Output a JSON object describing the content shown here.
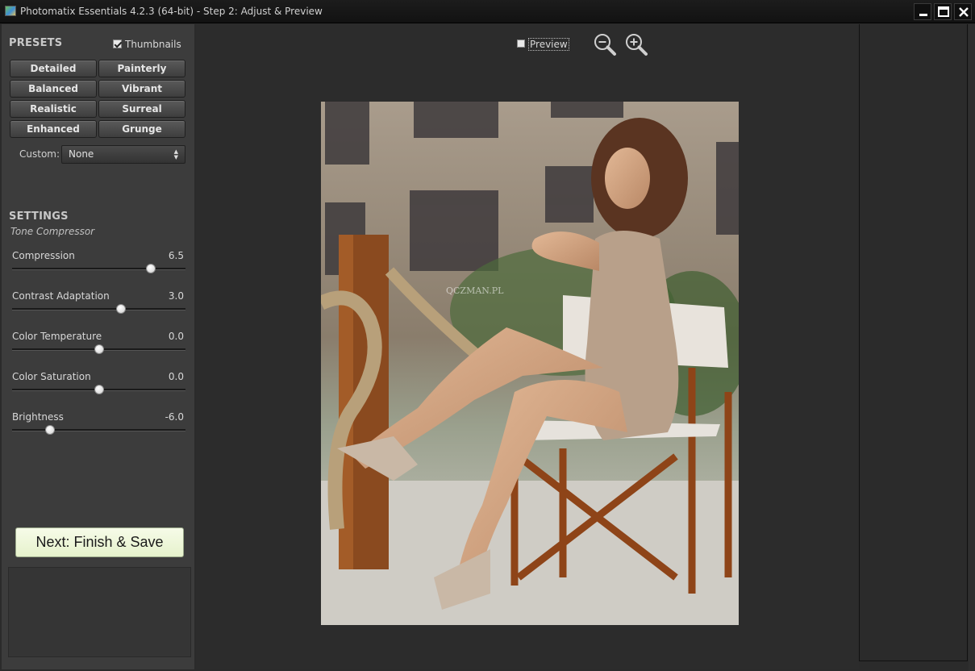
{
  "window": {
    "title": "Photomatix Essentials 4.2.3 (64-bit) - Step 2: Adjust & Preview",
    "controls": [
      "minimize-icon",
      "maximize-icon",
      "close-icon"
    ]
  },
  "presets": {
    "heading": "PRESETS",
    "thumbnails_label": "Thumbnails",
    "thumbnails_checked": true,
    "buttons": [
      "Detailed",
      "Painterly",
      "Balanced",
      "Vibrant",
      "Realistic",
      "Surreal",
      "Enhanced",
      "Grunge"
    ],
    "custom_label": "Custom:",
    "custom_value": "None"
  },
  "settings": {
    "heading": "SETTINGS",
    "method": "Tone Compressor",
    "sliders": [
      {
        "label": "Compression",
        "value": "6.5",
        "fraction": 0.8
      },
      {
        "label": "Contrast Adaptation",
        "value": "3.0",
        "fraction": 0.63
      },
      {
        "label": "Color Temperature",
        "value": "0.0",
        "fraction": 0.5
      },
      {
        "label": "Color Saturation",
        "value": "0.0",
        "fraction": 0.5
      },
      {
        "label": "Brightness",
        "value": "-6.0",
        "fraction": 0.22
      }
    ]
  },
  "actions": {
    "next_label": "Next: Finish & Save"
  },
  "preview": {
    "label": "Preview",
    "checked": false,
    "zoom_out_icon": "zoom-out-icon",
    "zoom_in_icon": "zoom-in-icon",
    "watermark": "QCZMAN.PL"
  },
  "colors": {
    "next_button": "#e9f4d2",
    "panel": "#3c3c3c",
    "background": "#2c2c2c"
  }
}
